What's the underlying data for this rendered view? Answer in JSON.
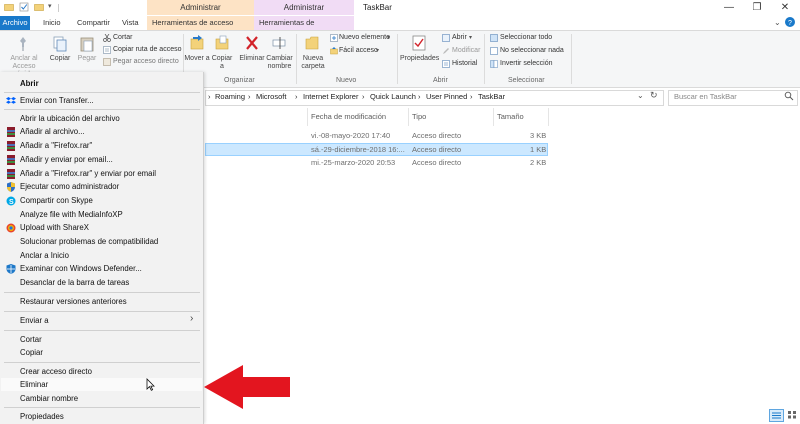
{
  "window": {
    "title": "TaskBar",
    "context_tabs": [
      "Administrar",
      "Administrar"
    ],
    "controls": [
      "—",
      "❐",
      "✕"
    ]
  },
  "tabs": [
    "Archivo",
    "Inicio",
    "Compartir",
    "Vista",
    "Herramientas de acceso directo",
    "Herramientas de aplicación"
  ],
  "ribbon": {
    "portapapeles": {
      "anclar": "Anclar al Acceso rápido",
      "copiar": "Copiar",
      "pegar": "Pegar",
      "cortar": "Cortar",
      "copiar_ruta": "Copiar ruta de acceso",
      "pegar_acceso": "Pegar acceso directo"
    },
    "organizar": {
      "mover": "Mover a",
      "copiar": "Copiar a",
      "eliminar": "Eliminar",
      "cambiar": "Cambiar nombre",
      "label": "Organizar"
    },
    "nuevo": {
      "nueva_carpeta": "Nueva carpeta",
      "nuevo_elemento": "Nuevo elemento",
      "facil_acceso": "Fácil acceso",
      "label": "Nuevo"
    },
    "abrir": {
      "propiedades": "Propiedades",
      "abrir": "Abrir",
      "modificar": "Modificar",
      "historial": "Historial",
      "label": "Abrir"
    },
    "seleccionar": {
      "todo": "Seleccionar todo",
      "nada": "No seleccionar nada",
      "invertir": "Invertir selección",
      "label": "Seleccionar"
    }
  },
  "address": {
    "crumbs": [
      "Roaming",
      "Microsoft",
      "Internet Explorer",
      "Quick Launch",
      "User Pinned",
      "TaskBar"
    ],
    "search_placeholder": "Buscar en TaskBar"
  },
  "columns": [
    "Fecha de modificación",
    "Tipo",
    "Tamaño"
  ],
  "rows": [
    {
      "fecha": "vi.-08-mayo-2020 17:40",
      "tipo": "Acceso directo",
      "tam": "3 KB"
    },
    {
      "fecha": "sá.-29-diciembre-2018 16:...",
      "tipo": "Acceso directo",
      "tam": "1 KB"
    },
    {
      "fecha": "mi.-25-marzo-2020 20:53",
      "tipo": "Acceso directo",
      "tam": "2 KB"
    }
  ],
  "menu": {
    "abrir": "Abrir",
    "enviar_transfer": "Enviar con Transfer...",
    "abrir_ubicacion": "Abrir la ubicación del archivo",
    "anadir_archivo": "Añadir al archivo...",
    "anadir_firefox": "Añadir a \"Firefox.rar\"",
    "anadir_enviar": "Añadir y enviar por email...",
    "anadir_firefox_enviar": "Añadir a \"Firefox.rar\" y enviar por email",
    "ejecutar_admin": "Ejecutar como administrador",
    "compartir_skype": "Compartir con Skype",
    "analyze": "Analyze file with MediaInfoXP",
    "sharex": "Upload with ShareX",
    "solucionar": "Solucionar problemas de compatibilidad",
    "anclar_inicio": "Anclar a Inicio",
    "defender": "Examinar con Windows Defender...",
    "desanclar": "Desanclar de la barra de tareas",
    "restaurar": "Restaurar versiones anteriores",
    "enviar_a": "Enviar a",
    "cortar": "Cortar",
    "copiar": "Copiar",
    "crear_acceso": "Crear acceso directo",
    "eliminar": "Eliminar",
    "cambiar_nombre": "Cambiar nombre",
    "propiedades": "Propiedades"
  },
  "colors": {
    "accent": "#1979ca",
    "selection": "#cce8ff",
    "arrow": "#e3151f"
  }
}
